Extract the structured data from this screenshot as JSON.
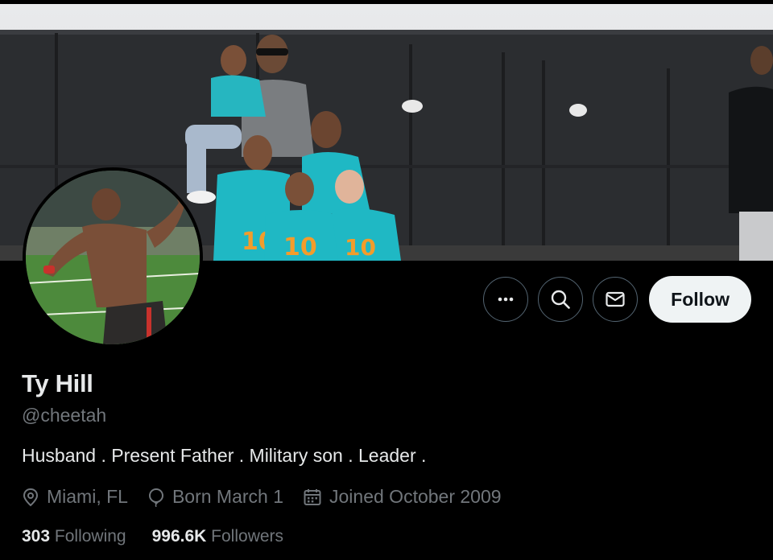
{
  "profile": {
    "name": "Ty Hill",
    "handle": "@cheetah",
    "bio": "Husband . Present Father . Military son . Leader .",
    "location": "Miami, FL",
    "birthday": "Born March 1",
    "joined": "Joined October 2009",
    "following_count": "303",
    "following_label": "Following",
    "followers_count": "996.6K",
    "followers_label": "Followers"
  },
  "actions": {
    "more_icon": "more-horizontal-icon",
    "search_icon": "search-icon",
    "message_icon": "envelope-icon",
    "follow_label": "Follow"
  },
  "colors": {
    "background": "#000000",
    "primary_text": "#e7e9ea",
    "secondary_text": "#71767b",
    "follow_button_bg": "#eff3f4",
    "button_border": "#536471",
    "jersey_aqua": "#1fb8c4"
  }
}
